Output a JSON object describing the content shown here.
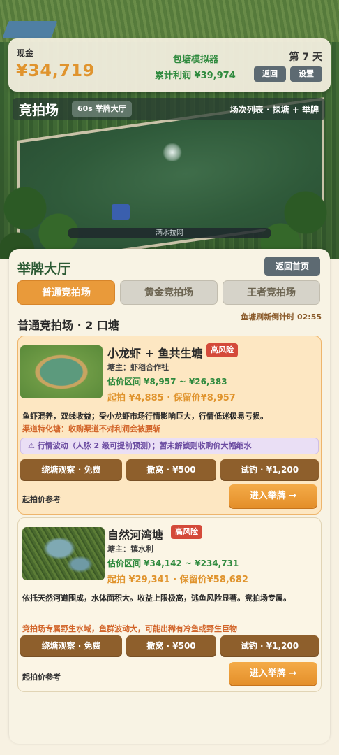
{
  "header": {
    "cash_label": "现金",
    "cash_value": "¥34,719",
    "game_title": "包塘模拟器",
    "profit": "累计利润 ¥39,974",
    "day": "第 7 天",
    "back_label": "返回",
    "settings_label": "设置"
  },
  "auction_bar": {
    "title": "竞拍场",
    "hall_badge": "60s 举牌大厅",
    "links": "场次列表 · 探塘 + 举牌"
  },
  "drain": {
    "label": "满水拉网",
    "progress": 0.0
  },
  "panel": {
    "title": "举牌大厅",
    "home_button": "返回首页",
    "tabs": [
      {
        "label": "普通竞拍场",
        "active": true
      },
      {
        "label": "黄金竞拍场",
        "active": false
      },
      {
        "label": "王者竞拍场",
        "active": false
      }
    ],
    "venue_title": "普通竞拍场 · 2 口塘",
    "countdown": "鱼塘刷新倒计时 02:55"
  },
  "ponds": [
    {
      "name": "小龙虾 + 鱼共生塘",
      "risk": "高风险",
      "owner": "塘主：虾稻合作社",
      "estimate": "估价区间 ¥8,957 ~ ¥26,383",
      "start_price": "起拍 ¥4,885 · 保留价¥8,957",
      "description": "鱼虾混养，双线收益；受小龙虾市场行情影响巨大，行情低迷极易亏损。",
      "special": "渠道特化塘：收购渠道不对利润会被腰斩",
      "market_notice": "⚠ 行情波动（人脉 2 级可提前预测）；暂未解锁则收购价大幅缩水",
      "actions": [
        "绕塘观察 · 免费",
        "撒窝 · ¥500",
        "试钓 · ¥1,200"
      ],
      "ref_label": "起拍价参考",
      "enter_label": "进入举牌 →"
    },
    {
      "name": "自然河湾塘",
      "risk": "高风险",
      "owner": "塘主：镇水利",
      "estimate": "估价区间 ¥34,142 ~ ¥234,731",
      "start_price": "起拍 ¥29,341 · 保留价¥58,682",
      "description": "依托天然河道围成，水体面积大。收益上限极高，逃鱼风险显著。竞拍场专属。",
      "special": "竞拍场专属野生水域，鱼群波动大，可能出稀有冷鱼或野生巨物",
      "actions": [
        "绕塘观察 · 免费",
        "撒窝 · ¥500",
        "试钓 · ¥1,200"
      ],
      "ref_label": "起拍价参考",
      "enter_label": "进入举牌 →"
    }
  ],
  "colors": {
    "accent_orange": "#e99a3a",
    "profit_green": "#2f8a3e",
    "risk_red": "#d44a3a",
    "action_brown": "#8e5f2c"
  }
}
